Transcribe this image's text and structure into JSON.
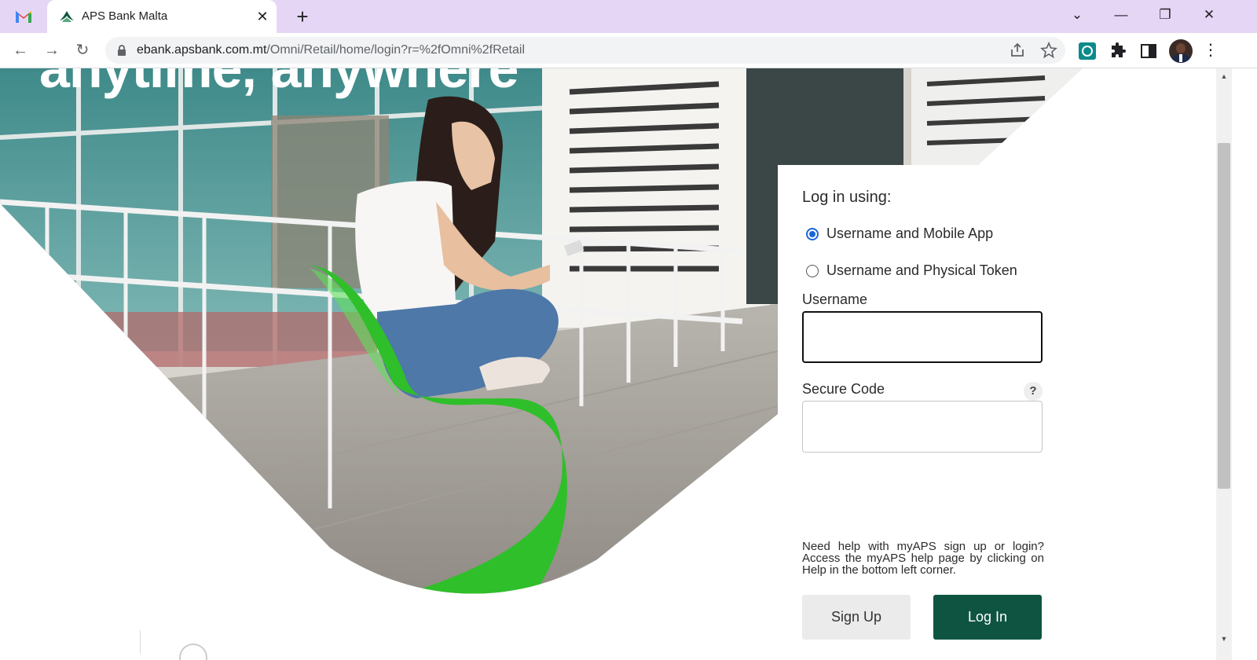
{
  "browser": {
    "tab_title": "APS Bank Malta",
    "url_host": "ebank.apsbank.com.mt",
    "url_path": "/Omni/Retail/home/login?r=%2fOmni%2fRetail"
  },
  "hero": {
    "headline": "anytime, anywhere"
  },
  "login": {
    "heading": "Log in using:",
    "options": [
      {
        "label": "Username and Mobile App",
        "selected": true
      },
      {
        "label": "Username and Physical Token",
        "selected": false
      }
    ],
    "username_label": "Username",
    "username_value": "",
    "secure_code_label": "Secure Code",
    "secure_code_value": "",
    "help_mark": "?",
    "help_text": "Need help with myAPS sign up or login? Access the myAPS help page by clicking on Help in the bottom left corner.",
    "signup_label": "Sign Up",
    "login_label": "Log In"
  },
  "colors": {
    "primary_green": "#0e5441",
    "chair_green": "#2fbf2a",
    "radio_blue": "#1a66d8",
    "tabbar": "#e6d6f5"
  }
}
